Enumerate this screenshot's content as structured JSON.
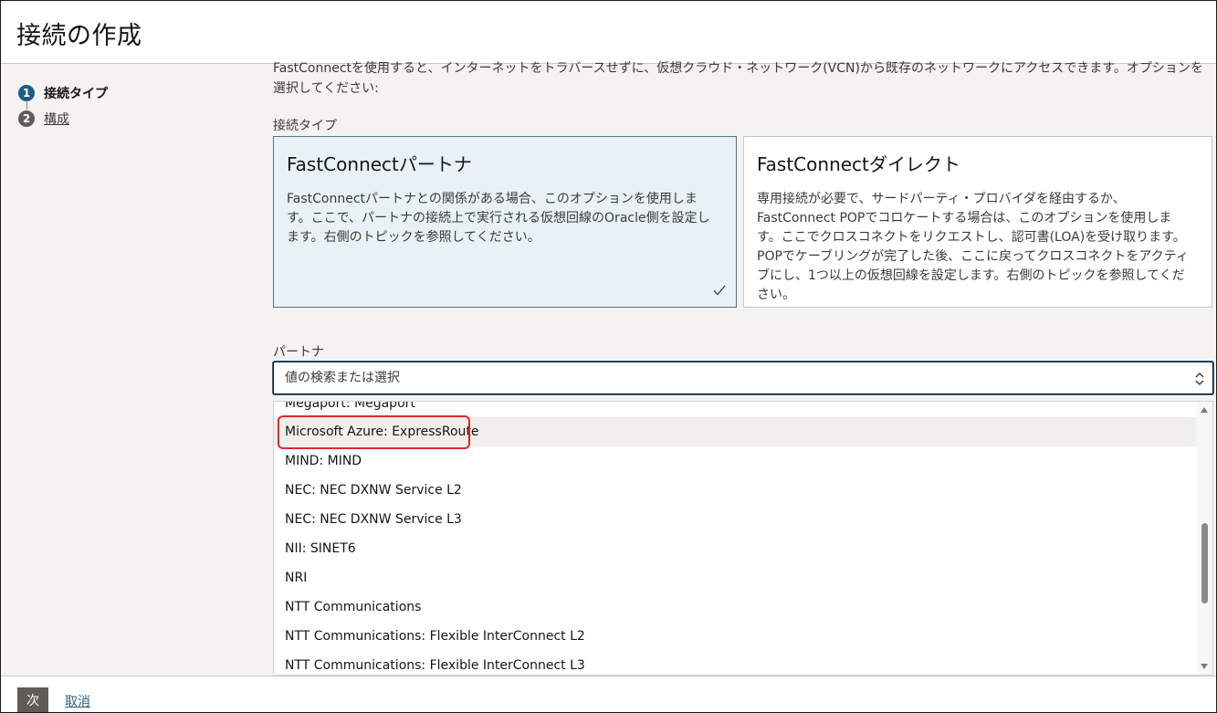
{
  "dialog": {
    "title": "接続の作成"
  },
  "steps": [
    {
      "number": "1",
      "label": "接続タイプ"
    },
    {
      "number": "2",
      "label": "構成"
    }
  ],
  "intro_text": "FastConnectを使用すると、インターネットをトラバースせずに、仮想クラウド・ネットワーク(VCN)から既存のネットワークにアクセスできます。オプションを選択してください:",
  "connection_type": {
    "label": "接続タイプ",
    "options": [
      {
        "title": "FastConnectパートナ",
        "description": "FastConnectパートナとの関係がある場合、このオプションを使用します。ここで、パートナの接続上で実行される仮想回線のOracle側を設定します。右側のトピックを参照してください。",
        "selected": true
      },
      {
        "title": "FastConnectダイレクト",
        "description": "専用接続が必要で、サードパーティ・プロバイダを経由するか、FastConnect POPでコロケートする場合は、このオプションを使用します。ここでクロスコネクトをリクエストし、認可書(LOA)を受け取ります。POPでケーブリングが完了した後、ここに戻ってクロスコネクトをアクティブにし、1つ以上の仮想回線を設定します。右側のトピックを参照してください。",
        "selected": false
      }
    ]
  },
  "partner": {
    "label": "パートナ",
    "placeholder": "値の検索または選択",
    "options": [
      "Megaport: Megaport",
      "Microsoft Azure: ExpressRoute",
      "MIND: MIND",
      "NEC: NEC DXNW Service L2",
      "NEC: NEC DXNW Service L3",
      "NII: SINET6",
      "NRI",
      "NTT Communications",
      "NTT Communications: Flexible InterConnect L2",
      "NTT Communications: Flexible InterConnect L3"
    ],
    "hovered_option": "Microsoft Azure: ExpressRoute",
    "annotation_color": "#e0262c"
  },
  "footer": {
    "next_label": "次",
    "cancel_label": "取消"
  },
  "colors": {
    "accent": "#1c5d86",
    "selected_card_bg": "#e8f1f5",
    "content_bg": "#f4f3f1"
  }
}
